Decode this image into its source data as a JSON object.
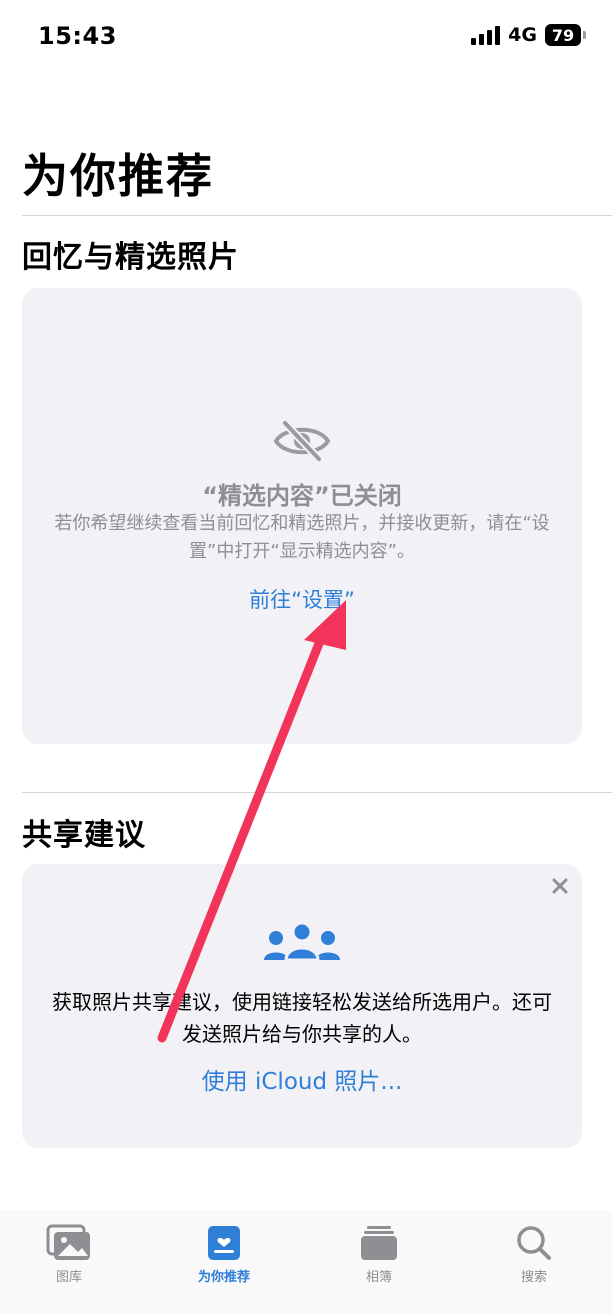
{
  "status_bar": {
    "time": "15:43",
    "network": "4G",
    "battery": "79"
  },
  "page": {
    "title": "为你推荐"
  },
  "memories": {
    "section_title": "回忆与精选照片",
    "off_title": "“精选内容”已关闭",
    "off_description": "若你希望继续查看当前回忆和精选照片，并接收更新，请在“设置”中打开“显示精选内容”。",
    "settings_link": "前往“设置”",
    "icon": "eye-slash-icon"
  },
  "sharing": {
    "section_title": "共享建议",
    "description": "获取照片共享建议，使用链接轻松发送给所选用户。还可发送照片给与你共享的人。",
    "icloud_link": "使用 iCloud 照片...",
    "icon": "people-icon",
    "close_icon": "close-icon"
  },
  "tab_bar": {
    "tabs": [
      {
        "label": "图库",
        "icon": "photo-library-icon",
        "active": false
      },
      {
        "label": "为你推荐",
        "icon": "for-you-icon",
        "active": true
      },
      {
        "label": "相簿",
        "icon": "albums-icon",
        "active": false
      },
      {
        "label": "搜索",
        "icon": "search-icon",
        "active": false
      }
    ]
  },
  "colors": {
    "accent": "#2f7ed8",
    "secondary_text": "#8e8e93",
    "card_background": "#f2f2f6",
    "annotation_arrow": "#f2345a"
  }
}
